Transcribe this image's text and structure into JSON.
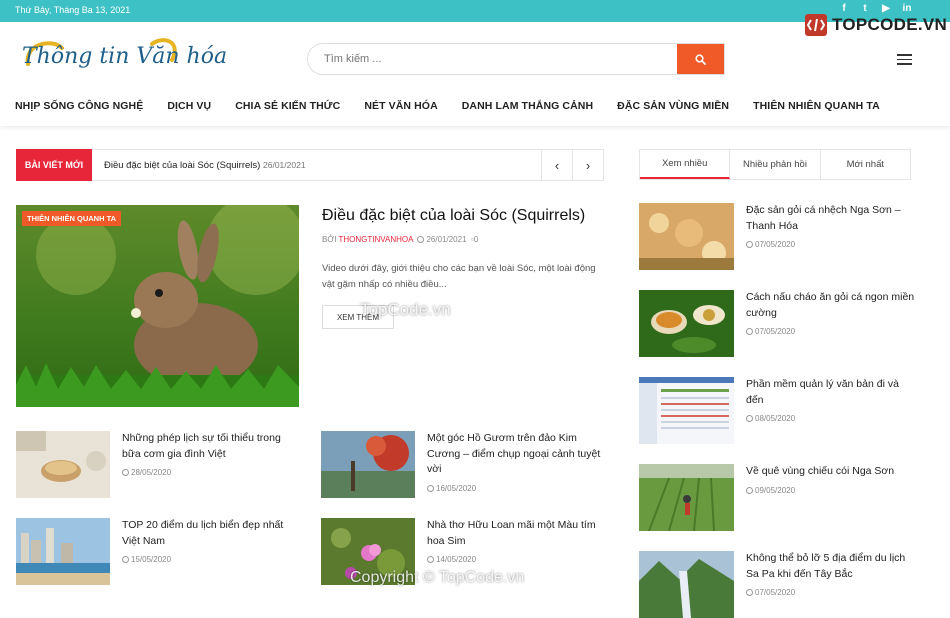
{
  "topbar": {
    "date": "Thứ Bảy, Tháng Ba 13, 2021",
    "social_icons": [
      "facebook-icon",
      "twitter-icon",
      "youtube-icon",
      "linkedin-icon"
    ],
    "social_glyphs": [
      "f",
      "t",
      "▶",
      "in"
    ]
  },
  "brand": {
    "text": "TOPCODE.VN"
  },
  "logo": {
    "text": "Thông tin Văn hóa"
  },
  "search": {
    "placeholder": "Tìm kiếm ..."
  },
  "nav": [
    "NHỊP SỐNG CÔNG NGHỆ",
    "DỊCH VỤ",
    "CHIA SẺ KIẾN THỨC",
    "NÉT VĂN HÓA",
    "DANH LAM THẮNG CẢNH",
    "ĐẶC SẢN VÙNG MIỀN",
    "THIÊN NHIÊN QUANH TA"
  ],
  "ticker": {
    "label": "BÀI VIẾT MỚI",
    "title": "Điều đặc biệt của loài Sóc (Squirrels)",
    "date": "26/01/2021",
    "prev": "‹",
    "next": "›"
  },
  "featured": {
    "category": "THIÊN NHIÊN QUANH TA",
    "title": "Điều đặc biệt của loài Sóc (Squirrels)",
    "by": "BỞI",
    "author": "THONGTINVANHOA",
    "date": "26/01/2021",
    "comments": "0",
    "excerpt": "Video dưới đây, giới thiệu cho các bạn về loài Sóc, một loài động vật gặm nhấp có nhiều điều...",
    "read_more": "XEM THÊM"
  },
  "posts": [
    {
      "title": "Những phép lịch sự tối thiểu trong bữa cơm gia đình Việt",
      "date": "28/05/2020"
    },
    {
      "title": "Một góc Hồ Gươm trên đảo Kim Cương – điểm chụp ngoại cảnh tuyệt vời",
      "date": "16/05/2020"
    },
    {
      "title": "TOP 20 điểm du lịch biển đẹp nhất Việt Nam",
      "date": "15/05/2020"
    },
    {
      "title": "Nhà thơ Hữu Loan mãi một Màu tím hoa Sim",
      "date": "14/05/2020"
    }
  ],
  "tabs": [
    "Xem nhiều",
    "Nhiều phản hồi",
    "Mới nhất"
  ],
  "sidebar": [
    {
      "title": "Đặc sản gỏi cá nhệch Nga Sơn – Thanh Hóa",
      "date": "07/05/2020"
    },
    {
      "title": "Cách nấu cháo ăn gỏi cá ngon miền cường",
      "date": "07/05/2020"
    },
    {
      "title": "Phần mềm quản lý văn bản đi và đến",
      "date": "08/05/2020"
    },
    {
      "title": "Về quê vùng chiếu cói Nga Sơn",
      "date": "09/05/2020"
    },
    {
      "title": "Không thể bỏ lỡ 5 địa điểm du lịch Sa Pa khi đến Tây Bắc",
      "date": "07/05/2020"
    }
  ],
  "watermarks": [
    "TopCode.vn",
    "Copyright © TopCode.vn"
  ],
  "colors": {
    "topbar": "#3ec1c5",
    "accent": "#e8263a",
    "search_button": "#f05a28"
  }
}
